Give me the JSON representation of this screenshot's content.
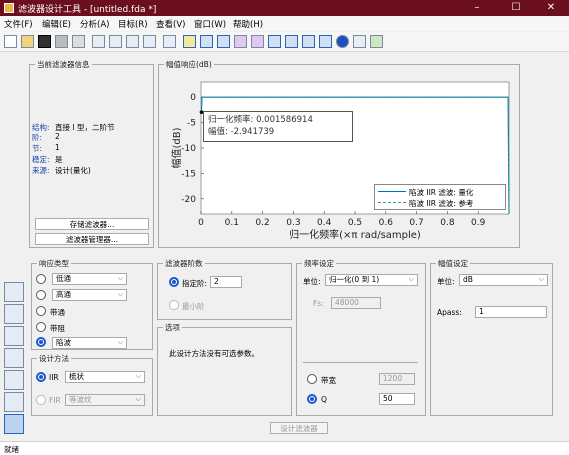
{
  "window": {
    "title": "滤波器设计工具 - [untitled.fda *]",
    "min": "–",
    "max": "☐",
    "close": "✕"
  },
  "menu": [
    "文件(F)",
    "编辑(E)",
    "分析(A)",
    "目标(R)",
    "查看(V)",
    "窗口(W)",
    "帮助(H)"
  ],
  "toolbar_icons": [
    "new-icon",
    "open-icon",
    "save-icon",
    "print-icon",
    "print-preview-icon",
    "zoom-in-icon",
    "zoom-x-icon",
    "zoom-y-icon",
    "full-view-icon",
    "specs-icon",
    "magnitude-response-icon",
    "phase-response-icon",
    "magnitude-phase-icon",
    "group-delay-icon",
    "phase-delay-icon",
    "impulse-response-icon",
    "step-response-icon",
    "pole-zero-icon",
    "coefficients-icon",
    "info-icon",
    "cost-icon",
    "legend-icon"
  ],
  "filter_info": {
    "title": "当前滤波器信息",
    "rows": [
      {
        "k": "结构:",
        "v": "直接 I 型，二阶节"
      },
      {
        "k": "阶:",
        "v": "2"
      },
      {
        "k": "节:",
        "v": "1"
      },
      {
        "k": "稳定:",
        "v": "是"
      },
      {
        "k": "来源:",
        "v": "设计(量化)"
      }
    ],
    "store_btn": "存储滤波器...",
    "manager_btn": "滤波器管理器..."
  },
  "plot": {
    "title": "幅值响应(dB)",
    "tooltip": {
      "line1": "归一化频率: 0.001586914",
      "line2": "幅值: -2.941739"
    },
    "legend": [
      "陷波 IIR 滤波: 量化",
      "陷波 IIR 滤波: 参考"
    ]
  },
  "chart_data": {
    "type": "line",
    "xlabel": "归一化频率(×π rad/sample)",
    "ylabel": "幅值(dB)",
    "xlim": [
      0,
      1
    ],
    "ylim": [
      -23,
      3
    ],
    "xticks": [
      "0",
      "0.1",
      "0.2",
      "0.3",
      "0.4",
      "0.5",
      "0.6",
      "0.7",
      "0.8",
      "0.9"
    ],
    "xtick_values": [
      0,
      0.1,
      0.2,
      0.3,
      0.4,
      0.5,
      0.6,
      0.7,
      0.8,
      0.9
    ],
    "yticks": [
      "0",
      "-5",
      "-10",
      "-15",
      "-20"
    ],
    "ytick_values": [
      0,
      -5,
      -10,
      -15,
      -20
    ],
    "series": [
      {
        "name": "陷波 IIR 滤波: 量化",
        "x": [
          0.0016,
          0.003,
          0.01,
          0.1,
          0.5,
          0.9,
          0.997,
          1.0
        ],
        "y": [
          -2.94,
          0,
          0,
          0,
          0,
          0,
          0,
          -23
        ]
      },
      {
        "name": "陷波 IIR 滤波: 参考",
        "x": [
          0.0016,
          0.003,
          0.01,
          0.1,
          0.5,
          0.9,
          0.997,
          1.0
        ],
        "y": [
          -2.94,
          0,
          0,
          0,
          0,
          0,
          0,
          -23
        ]
      }
    ],
    "datatip": {
      "x": 0.001586914,
      "y": -2.941739
    }
  },
  "response_type": {
    "title": "响应类型",
    "items": [
      {
        "label": "低通",
        "type": "select"
      },
      {
        "label": "高通",
        "type": "select"
      },
      {
        "label": "带通",
        "type": "plain"
      },
      {
        "label": "带阻",
        "type": "plain"
      },
      {
        "label": "陷波",
        "type": "select",
        "checked": true
      }
    ]
  },
  "design_method": {
    "title": "设计方法",
    "iir": {
      "label": "IIR",
      "value": "梳状"
    },
    "fir": {
      "label": "FIR",
      "value": "等波纹"
    }
  },
  "filter_order": {
    "title": "滤波器阶数",
    "specify": "指定阶:",
    "order": "2",
    "min": "最小阶"
  },
  "options": {
    "title": "选项",
    "text": "此设计方法没有可选参数。"
  },
  "freq_spec": {
    "title": "频率设定",
    "unit_label": "单位:",
    "unit": "归一化(0 到 1)",
    "fs_label": "Fs:",
    "fs": "48000",
    "bw_label": "带宽",
    "bw": "1200",
    "q_label": "Q",
    "q": "50"
  },
  "mag_spec": {
    "title": "幅值设定",
    "unit_label": "单位:",
    "unit": "dB",
    "apass_label": "Apass:",
    "apass": "1"
  },
  "design_btn": "设计滤波器",
  "status": "就绪",
  "sidebar_icons": [
    "pole-zero-editor-icon",
    "transform-filter-icon",
    "quantization-icon",
    "realize-model-icon",
    "import-filter-icon",
    "multirate-icon",
    "design-filter-icon"
  ],
  "colors": {
    "titlebar": "#6b0f1e",
    "plot_line": "#0072bd",
    "ref_line": "#2a9d8f"
  }
}
